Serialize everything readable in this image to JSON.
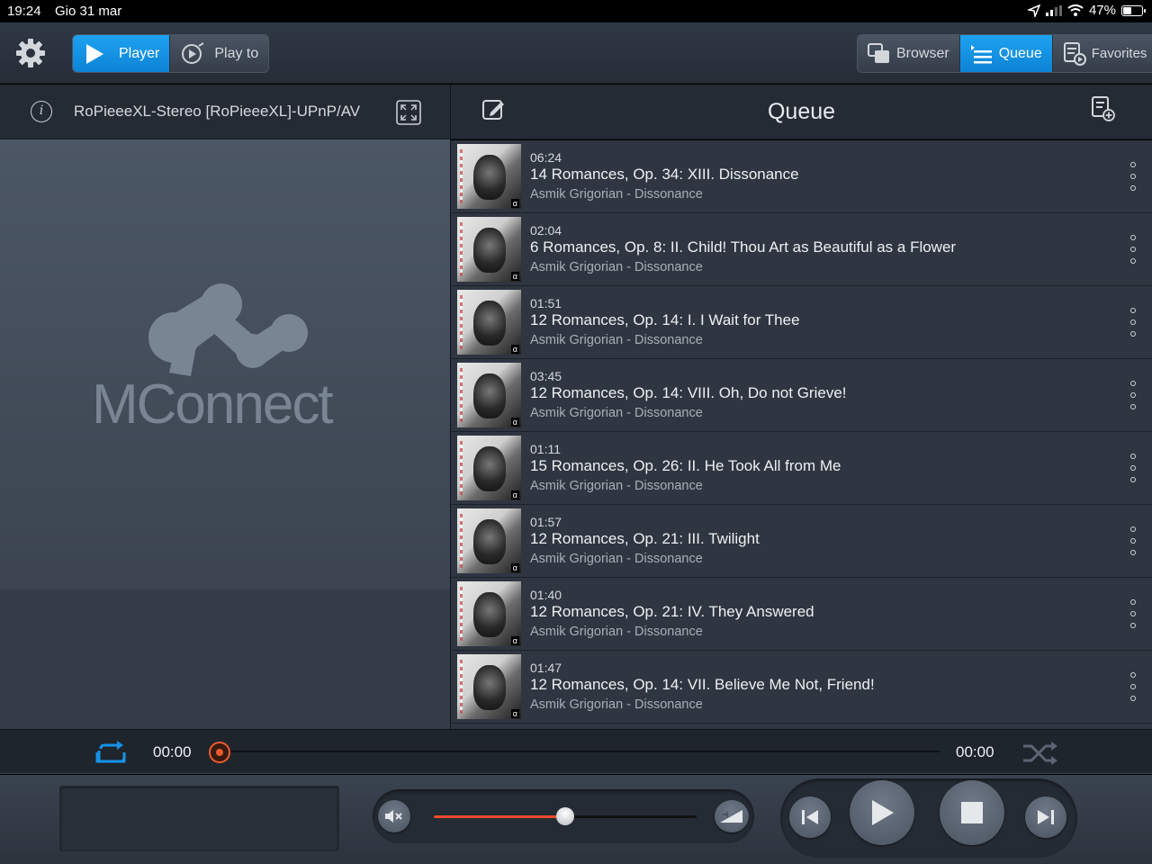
{
  "status_bar": {
    "time": "19:24",
    "date": "Gio 31 mar",
    "battery": "47%",
    "battery_level": 0.47
  },
  "toolbar": {
    "left_tabs": [
      {
        "label": "Player",
        "icon": "play-icon",
        "active": true
      },
      {
        "label": "Play to",
        "icon": "play-to-icon",
        "active": false
      }
    ],
    "right_tabs": [
      {
        "label": "Browser",
        "icon": "browser-icon",
        "active": false
      },
      {
        "label": "Queue",
        "icon": "queue-icon",
        "active": true
      },
      {
        "label": "Favorites",
        "icon": "favorites-icon",
        "active": false
      }
    ]
  },
  "player": {
    "renderer": "RoPieeeXL-Stereo [RoPieeeXL]-UPnP/AV",
    "logo_text": "MConnect"
  },
  "queue": {
    "title": "Queue",
    "items": [
      {
        "duration": "06:24",
        "title": "14 Romances, Op. 34: XIII. Dissonance",
        "subtitle": "Asmik Grigorian - Dissonance"
      },
      {
        "duration": "02:04",
        "title": "6 Romances, Op. 8: II. Child! Thou Art as Beautiful as a Flower",
        "subtitle": "Asmik Grigorian - Dissonance"
      },
      {
        "duration": "01:51",
        "title": "12 Romances, Op. 14: I. I Wait for Thee",
        "subtitle": "Asmik Grigorian - Dissonance"
      },
      {
        "duration": "03:45",
        "title": "12 Romances, Op. 14: VIII. Oh, Do not Grieve!",
        "subtitle": "Asmik Grigorian - Dissonance"
      },
      {
        "duration": "01:11",
        "title": "15 Romances, Op. 26: II. He Took All from Me",
        "subtitle": "Asmik Grigorian - Dissonance"
      },
      {
        "duration": "01:57",
        "title": "12 Romances, Op. 21: III. Twilight",
        "subtitle": "Asmik Grigorian - Dissonance"
      },
      {
        "duration": "01:40",
        "title": "12 Romances, Op. 21: IV. They Answered",
        "subtitle": "Asmik Grigorian - Dissonance"
      },
      {
        "duration": "01:47",
        "title": "12 Romances, Op. 14: VII. Believe Me Not, Friend!",
        "subtitle": "Asmik Grigorian - Dissonance"
      }
    ]
  },
  "progress": {
    "elapsed": "00:00",
    "total": "00:00",
    "position": 0
  },
  "volume": {
    "level": 0.5
  },
  "colors": {
    "accent": "#1592e6",
    "progress": "#ec5b2d",
    "background": "#2f3641"
  }
}
